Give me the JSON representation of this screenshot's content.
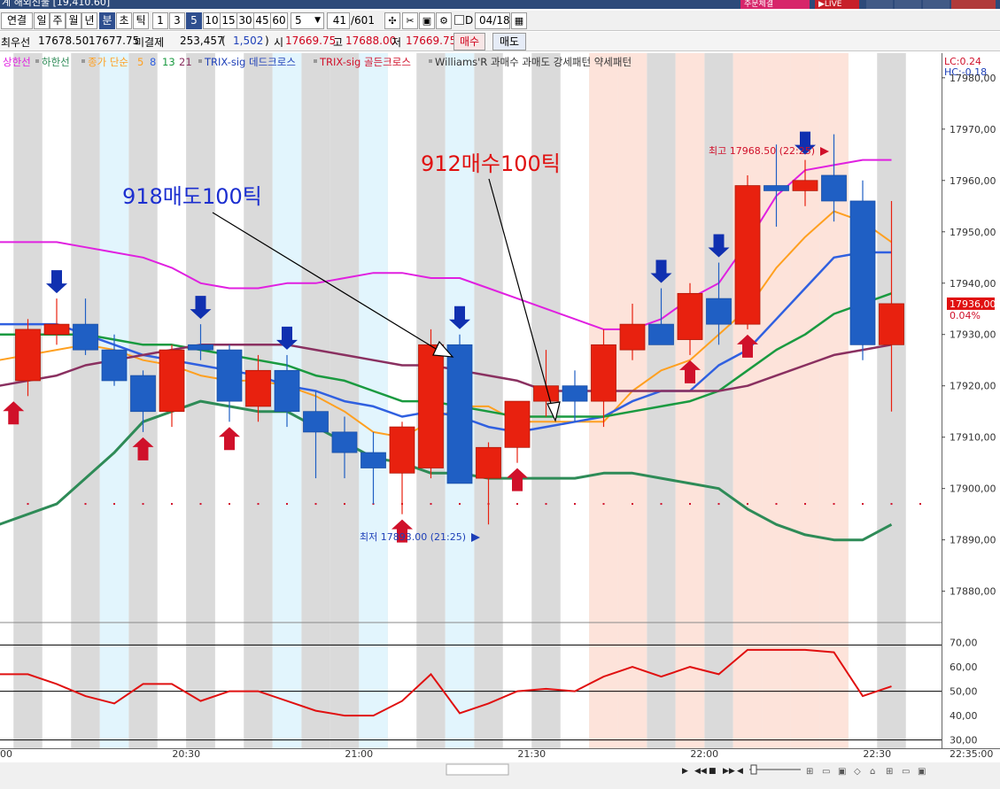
{
  "window": {
    "title": "계 해외선물 [19,410.60]",
    "btn_realtime": "주문체결",
    "btn_live": "▶LIVE"
  },
  "toolbar": {
    "linked": "연결",
    "periods": [
      "일",
      "주",
      "월",
      "년",
      "분",
      "초",
      "틱"
    ],
    "active_period": "분",
    "intervals": [
      "1",
      "3",
      "5",
      "10",
      "15",
      "30",
      "45",
      "60"
    ],
    "active_interval": "5",
    "count_select": "5",
    "range_value": "41",
    "range_total": "/601",
    "date_checkbox_label": "D",
    "date_value": "04/18"
  },
  "quote": {
    "best_label": "최우선",
    "bid": "17678.50",
    "ask": "17677.75",
    "open_interest_label": "미결제",
    "open_interest": "253,457",
    "oi_change_open": "(",
    "oi_change": "1,502",
    "oi_change_close": ")",
    "open_label": "시",
    "open": "17669.75",
    "high_label": "고",
    "high": "17688.00",
    "low_label": "저",
    "low": "17669.75",
    "buy_label": "매수",
    "sell_label": "매도"
  },
  "legend": {
    "upper_band": "상한선",
    "lower_band": "하한선",
    "ma_label": "종가 단순",
    "ma_periods": [
      "5",
      "8",
      "13",
      "21"
    ],
    "trix_dead": "TRIX-sig 데드크로스",
    "trix_golden": "TRIX-sig 골든크로스",
    "williams": "Williams'R 과매수 과매도 강세패턴  약세패턴"
  },
  "colors": {
    "up": "#e8210f",
    "down": "#1f5fc4",
    "upper_band": "#e020e0",
    "lower_band": "#2e8b57",
    "ma5": "#ffa020",
    "ma8": "#3060e0",
    "ma13": "#1a9a40",
    "ma21": "#8a3060",
    "buy_arrow": "#d0102a",
    "sell_arrow": "#1030b0",
    "grid_gray": "#dadada",
    "band_blue": "#e2f5fd",
    "band_pink": "#fde3da"
  },
  "chart_data": {
    "type": "candlestick",
    "xlabel": "",
    "ylabel": "",
    "ylim": [
      17873.9,
      17984.8
    ],
    "y_ticks": [
      "17980,00",
      "17970,00",
      "17960,00",
      "17950,00",
      "17940,00",
      "17930,00",
      "17920,00",
      "17910,00",
      "17900,00",
      "17890,00",
      "17880,00"
    ],
    "x_ticks": [
      {
        "label": "00",
        "bar": -0.5
      },
      {
        "label": "20:30",
        "bar": 5.5
      },
      {
        "label": "21:00",
        "bar": 11.5
      },
      {
        "label": "21:30",
        "bar": 17.5
      },
      {
        "label": "22:00",
        "bar": 23.5
      },
      {
        "label": "22:30",
        "bar": 29.5
      },
      {
        "label": "22:35:00",
        "bar": 31.5
      }
    ],
    "lc_label": "LC:0.24",
    "hc_label": "HC:-0.18",
    "last_price": "17936,00",
    "last_change": "0.04%",
    "candles": [
      {
        "o": 17921,
        "h": 17933,
        "l": 17918,
        "c": 17931
      },
      {
        "o": 17930,
        "h": 17937,
        "l": 17928,
        "c": 17932
      },
      {
        "o": 17932,
        "h": 17937,
        "l": 17926,
        "c": 17927
      },
      {
        "o": 17927,
        "h": 17930,
        "l": 17920,
        "c": 17921
      },
      {
        "o": 17922,
        "h": 17923,
        "l": 17911,
        "c": 17915
      },
      {
        "o": 17915,
        "h": 17928,
        "l": 17912,
        "c": 17927
      },
      {
        "o": 17928,
        "h": 17932,
        "l": 17925,
        "c": 17927
      },
      {
        "o": 17927,
        "h": 17928,
        "l": 17913,
        "c": 17917
      },
      {
        "o": 17916,
        "h": 17926,
        "l": 17913,
        "c": 17923
      },
      {
        "o": 17923,
        "h": 17926,
        "l": 17912,
        "c": 17915
      },
      {
        "o": 17915,
        "h": 17919,
        "l": 17902,
        "c": 17911
      },
      {
        "o": 17911,
        "h": 17914,
        "l": 17902,
        "c": 17907
      },
      {
        "o": 17907,
        "h": 17911,
        "l": 17897,
        "c": 17904
      },
      {
        "o": 17903,
        "h": 17913,
        "l": 17895,
        "c": 17912
      },
      {
        "o": 17904,
        "h": 17931,
        "l": 17902,
        "c": 17928
      },
      {
        "o": 17928,
        "h": 17930,
        "l": 17901,
        "c": 17901
      },
      {
        "o": 17902,
        "h": 17909,
        "l": 17893,
        "c": 17908
      },
      {
        "o": 17908,
        "h": 17917,
        "l": 17905,
        "c": 17917
      },
      {
        "o": 17917,
        "h": 17927,
        "l": 17914,
        "c": 17920
      },
      {
        "o": 17920,
        "h": 17923,
        "l": 17913,
        "c": 17917
      },
      {
        "o": 17917,
        "h": 17931,
        "l": 17912,
        "c": 17928
      },
      {
        "o": 17927,
        "h": 17936,
        "l": 17925,
        "c": 17932
      },
      {
        "o": 17932,
        "h": 17939,
        "l": 17929,
        "c": 17928
      },
      {
        "o": 17929,
        "h": 17940,
        "l": 17926,
        "c": 17938
      },
      {
        "o": 17937,
        "h": 17944,
        "l": 17928,
        "c": 17932
      },
      {
        "o": 17932,
        "h": 17961,
        "l": 17931,
        "c": 17959
      },
      {
        "o": 17959,
        "h": 17967,
        "l": 17951,
        "c": 17958
      },
      {
        "o": 17958,
        "h": 17964,
        "l": 17955,
        "c": 17960
      },
      {
        "o": 17961,
        "h": 17969,
        "l": 17952,
        "c": 17956
      },
      {
        "o": 17956,
        "h": 17960,
        "l": 17925,
        "c": 17928
      },
      {
        "o": 17928,
        "h": 17956,
        "l": 17915,
        "c": 17936
      }
    ],
    "series": [
      {
        "key": "upper_band",
        "name": "상한선",
        "values": [
          17948,
          17948,
          17947,
          17946,
          17945,
          17943,
          17940,
          17939,
          17939,
          17940,
          17940,
          17941,
          17942,
          17942,
          17941,
          17941,
          17939,
          17937,
          17935,
          17933,
          17931,
          17931,
          17933,
          17937,
          17940,
          17948,
          17957,
          17962,
          17963,
          17964,
          17964
        ]
      },
      {
        "key": "lower_band",
        "name": "하한선",
        "values": [
          17893,
          17897,
          17902,
          17907,
          17913,
          17915,
          17917,
          17916,
          17915,
          17915,
          17912,
          17909,
          17906,
          17905,
          17903,
          17903,
          17902,
          17902,
          17902,
          17902,
          17903,
          17903,
          17902,
          17901,
          17900,
          17896,
          17893,
          17891,
          17890,
          17890,
          17893
        ]
      },
      {
        "key": "ma5",
        "name": "5",
        "values": [
          17925,
          17927,
          17928,
          17927,
          17925,
          17924,
          17922,
          17921,
          17921,
          17920,
          17918,
          17915,
          17911,
          17910,
          17913,
          17916,
          17916,
          17913,
          17913,
          17913,
          17913,
          17919,
          17923,
          17925,
          17930,
          17935,
          17943,
          17949,
          17954,
          17952,
          17948
        ]
      },
      {
        "key": "ma8",
        "name": "8",
        "values": [
          17932,
          17932,
          17930,
          17928,
          17926,
          17925,
          17924,
          17923,
          17922,
          17920,
          17919,
          17917,
          17916,
          17914,
          17915,
          17914,
          17912,
          17911,
          17912,
          17913,
          17914,
          17917,
          17919,
          17919,
          17924,
          17927,
          17933,
          17939,
          17945,
          17946,
          17946
        ]
      },
      {
        "key": "ma13",
        "name": "13",
        "values": [
          17930,
          17930,
          17930,
          17929,
          17928,
          17928,
          17927,
          17926,
          17925,
          17924,
          17922,
          17921,
          17919,
          17917,
          17917,
          17916,
          17915,
          17914,
          17914,
          17914,
          17914,
          17915,
          17916,
          17917,
          17919,
          17923,
          17927,
          17930,
          17934,
          17936,
          17938
        ]
      },
      {
        "key": "ma21",
        "name": "21",
        "values": [
          17920,
          17922,
          17924,
          17925,
          17926,
          17927,
          17928,
          17928,
          17928,
          17928,
          17927,
          17926,
          17925,
          17924,
          17924,
          17923,
          17922,
          17921,
          17919,
          17919,
          17919,
          17919,
          17919,
          17919,
          17919,
          17920,
          17922,
          17924,
          17926,
          17927,
          17928
        ]
      }
    ],
    "williams_r": {
      "y_ticks": [
        "70,00",
        "60,00",
        "50,00",
        "40,00",
        "30,00"
      ],
      "ylim": [
        26.6,
        77.5
      ],
      "lines": [
        69,
        50,
        30
      ],
      "values": [
        57,
        57,
        53,
        48,
        45,
        53,
        53,
        46,
        50,
        50,
        46,
        42,
        40,
        40,
        46,
        57,
        41,
        45,
        50,
        51,
        50,
        56,
        60,
        56,
        60,
        57,
        67,
        67,
        67,
        66,
        48,
        52
      ]
    },
    "background_bands": [
      {
        "bar": 3,
        "tone": "blue"
      },
      {
        "bar": 6,
        "tone": "gray"
      },
      {
        "bar": 9,
        "tone": "blue"
      },
      {
        "bar": 11,
        "tone": "gray"
      },
      {
        "bar": 12,
        "tone": "blue"
      },
      {
        "bar": 15,
        "tone": "blue"
      },
      {
        "bar": 20,
        "tone": "pink"
      },
      {
        "bar": 21,
        "tone": "pink"
      },
      {
        "bar": 23,
        "tone": "pink"
      },
      {
        "bar": 25,
        "tone": "pink"
      },
      {
        "bar": 26,
        "tone": "pink"
      },
      {
        "bar": 27,
        "tone": "pink"
      },
      {
        "bar": 28,
        "tone": "pink"
      }
    ],
    "buy_signals": [
      -0.5,
      4,
      7,
      13,
      17,
      23,
      25
    ],
    "sell_signals": [
      1,
      6,
      9,
      15,
      22,
      24,
      27
    ],
    "annotations": {
      "sell_note": "918매도100틱",
      "buy_note": "912매수100틱",
      "high_label": "최고 17968.50 (22:25)",
      "high_value": 17968.5,
      "high_bar": 27,
      "low_label": "최저 17893.00 (21:25)",
      "low_value": 17893.0,
      "low_bar": 16
    }
  }
}
